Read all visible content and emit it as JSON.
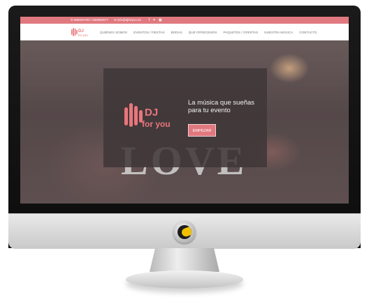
{
  "topbar": {
    "phone": "665034783 / 608952677",
    "email": "info@djforyou.es",
    "social": [
      "facebook-icon",
      "twitter-icon",
      "instagram-icon"
    ]
  },
  "logo": {
    "line1": "DJ",
    "line2": "for you"
  },
  "nav": {
    "items": [
      "Quiénes somos",
      "Eventos / Fiestas",
      "Bodas",
      "Qué ofrecemos",
      "Paquetes / Ofertas",
      "Nuestra música",
      "Contacto"
    ]
  },
  "hero": {
    "tagline": "La música que sueñas para tu evento",
    "button": "EMPEZAR",
    "background_word": "LOVE"
  },
  "colors": {
    "accent": "#e0797f",
    "logo_pink": "#e8767d",
    "overlay": "#3e3637"
  }
}
